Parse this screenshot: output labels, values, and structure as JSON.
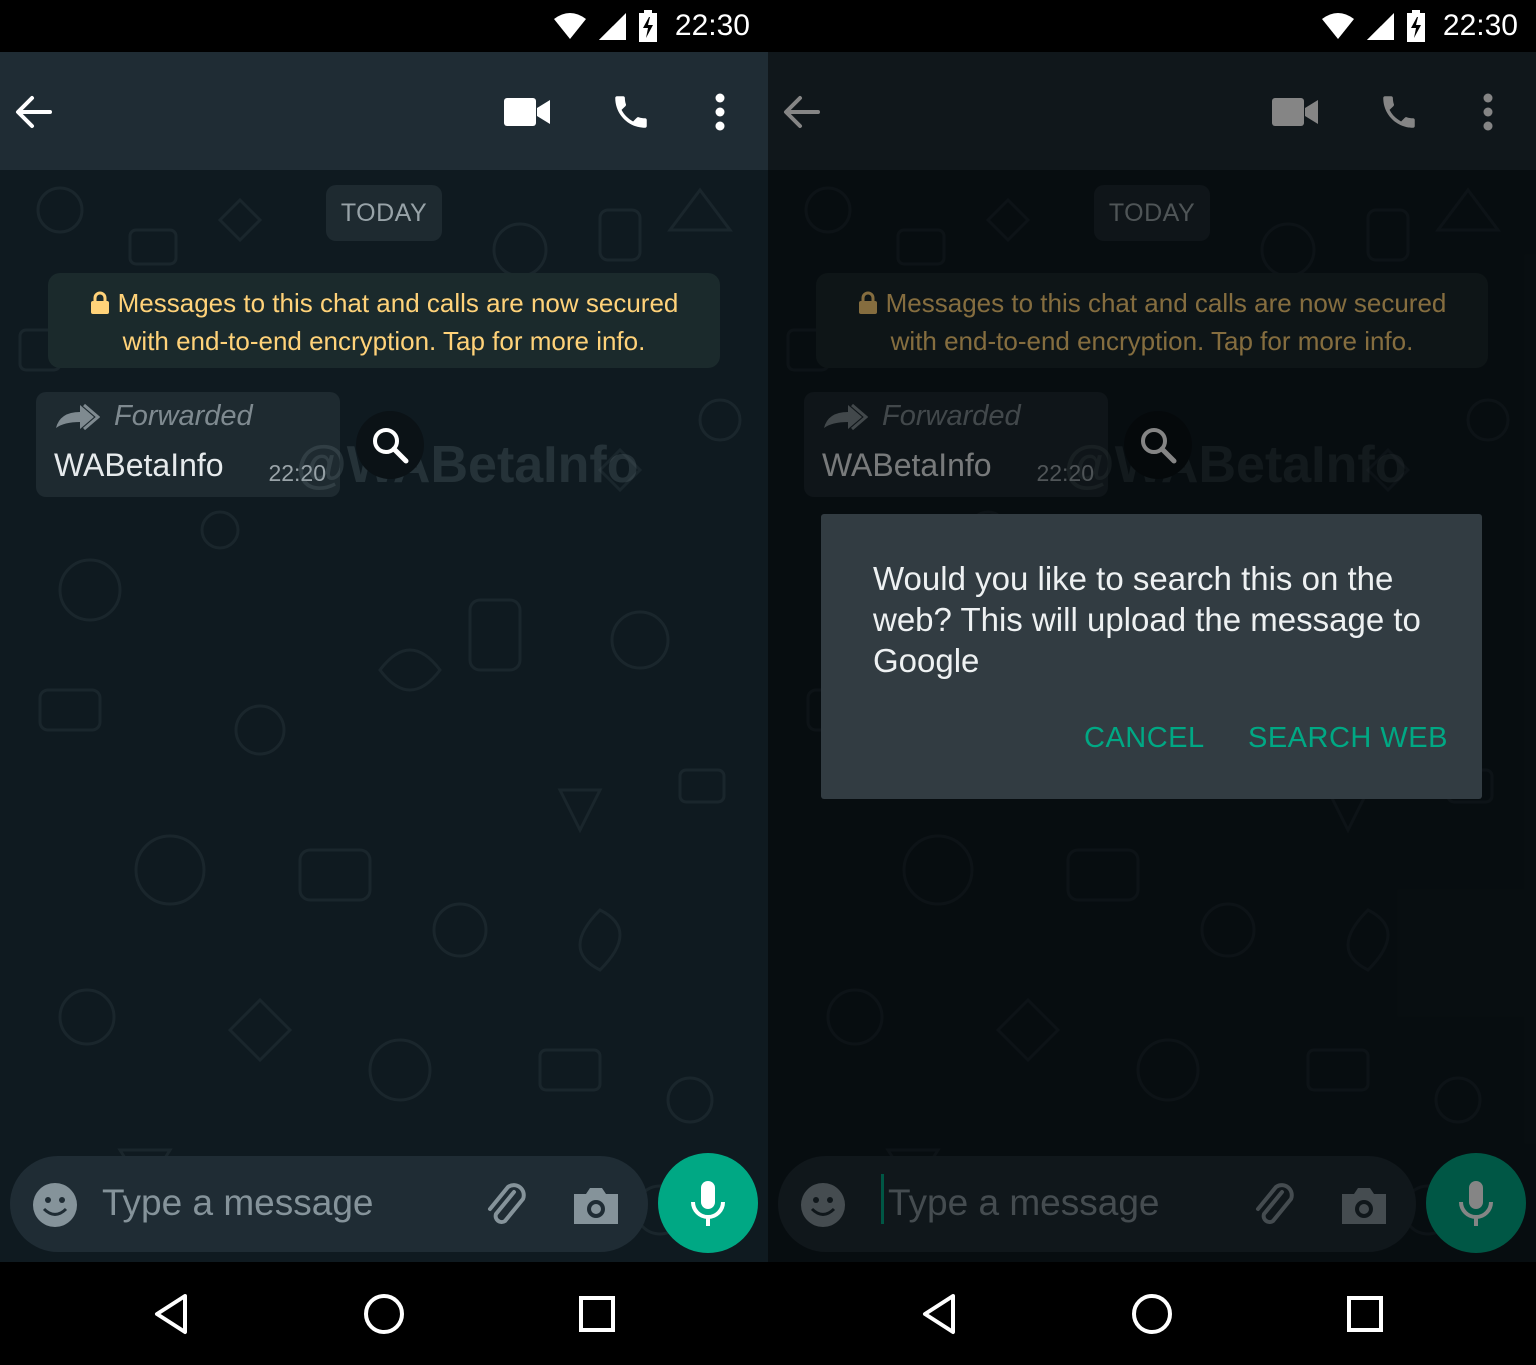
{
  "status_bar": {
    "time": "22:30"
  },
  "chat": {
    "date_chip": "TODAY",
    "encryption_notice": {
      "line1": "Messages to this chat and calls are now secured",
      "line2": "with end-to-end encryption. Tap for more info."
    },
    "message": {
      "forwarded_label": "Forwarded",
      "text": "WABetaInfo",
      "time": "22:20"
    },
    "watermark": "@WABetaInfo"
  },
  "composer": {
    "placeholder": "Type a message"
  },
  "dialog": {
    "message": "Would you like to search this on the web? This will upload the message to Google",
    "cancel_label": "CANCEL",
    "confirm_label": "SEARCH WEB"
  },
  "colors": {
    "accent": "#00a884",
    "notice_text": "#ffd279",
    "toolbar": "#1f2c34",
    "chat_background": "#0f1a20"
  },
  "icons": {
    "toolbar": [
      "back-arrow-icon",
      "video-call-icon",
      "phone-icon",
      "more-vert-icon"
    ],
    "status": [
      "wifi-icon",
      "signal-icon",
      "battery-charging-icon"
    ],
    "composer": [
      "emoji-icon",
      "attach-icon",
      "camera-icon",
      "mic-icon"
    ],
    "nav": [
      "nav-back-icon",
      "nav-home-icon",
      "nav-recents-icon"
    ]
  }
}
